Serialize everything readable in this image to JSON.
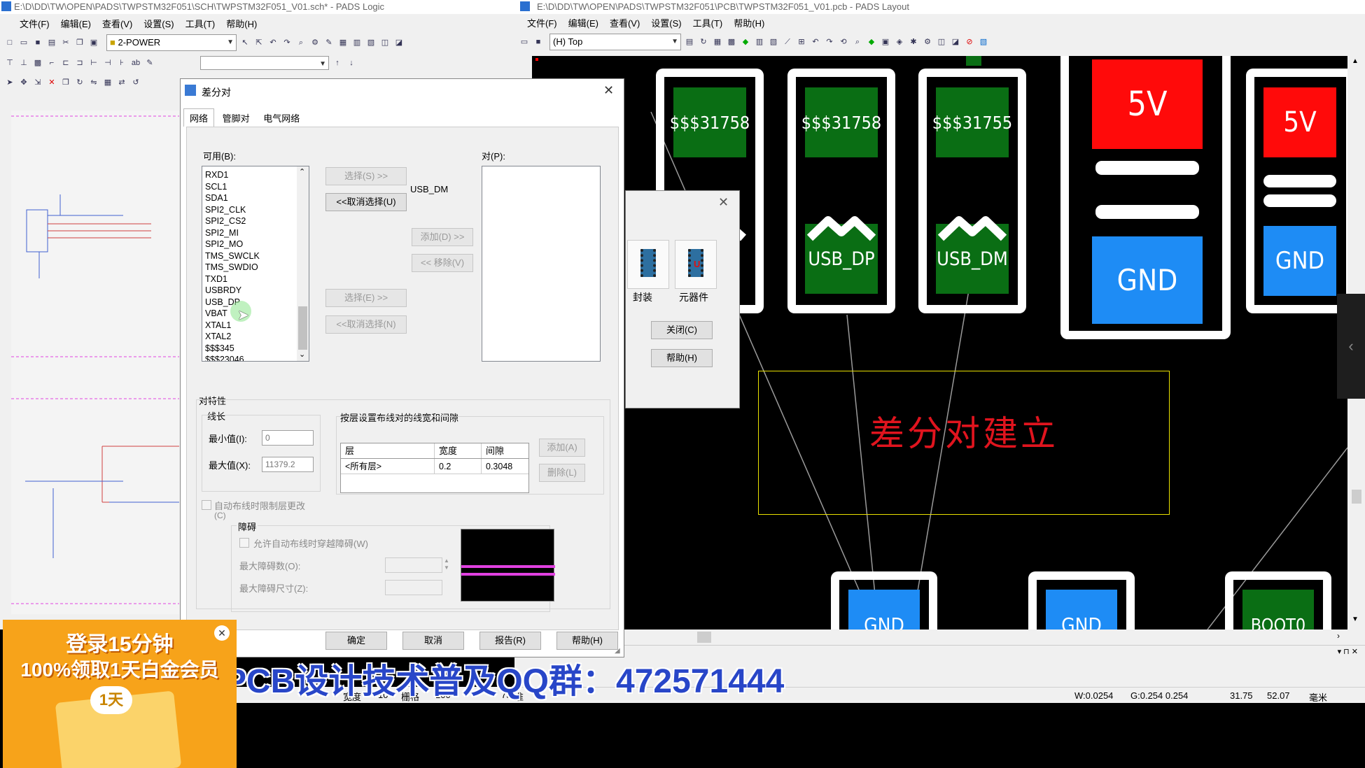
{
  "logic_window": {
    "title": "E:\\D\\DD\\TW\\OPEN\\PADS\\TWPSTM32F051\\SCH\\TWPSTM32F051_V01.sch* - PADS Logic",
    "menus": [
      "文件(F)",
      "编辑(E)",
      "查看(V)",
      "设置(S)",
      "工具(T)",
      "帮助(H)"
    ],
    "layer_combo": "2-POWER"
  },
  "layout_window": {
    "title": "E:\\D\\DD\\TW\\OPEN\\PADS\\TWPSTM32F051\\PCB\\TWPSTM32F051_V01.pcb - PADS Layout",
    "menus": [
      "文件(F)",
      "编辑(E)",
      "查看(V)",
      "设置(S)",
      "工具(T)",
      "帮助(H)"
    ],
    "layer_combo": "(H) Top",
    "status": {
      "w": "W:0.0254",
      "g": "G:0.254 0.254",
      "x": "31.75",
      "y": "52.07",
      "unit": "毫米"
    },
    "bottom_status": {
      "width_label": "宽度",
      "width_value": "10",
      "grid_label": "栅格",
      "grid_value": "100",
      "num": "75",
      "ready": "准备就绪"
    }
  },
  "pcb": {
    "pads": [
      {
        "name": "$$$31758",
        "color": "green"
      },
      {
        "name": "$$$31758",
        "color": "green"
      },
      {
        "name": "$$$31755",
        "color": "green"
      },
      {
        "name": "5V",
        "color": "red"
      },
      {
        "name": "5V",
        "color": "red"
      },
      {
        "name": "USB_DP",
        "color": "green"
      },
      {
        "name": "USB_DM",
        "color": "green"
      },
      {
        "name": "GND",
        "color": "blue"
      },
      {
        "name": "GND",
        "color": "blue"
      },
      {
        "name": "GND",
        "color": "blue"
      },
      {
        "name": "GND",
        "color": "blue"
      },
      {
        "name": "BOOT0",
        "color": "green"
      }
    ],
    "annotation": "差分对建立"
  },
  "diff_dialog": {
    "title": "差分对",
    "tabs": [
      "网络",
      "管脚对",
      "电气网络"
    ],
    "available_label": "可用(B):",
    "available_items": [
      "RXD1",
      "SCL1",
      "SDA1",
      "SPI2_CLK",
      "SPI2_CS2",
      "SPI2_MI",
      "SPI2_MO",
      "TMS_SWCLK",
      "TMS_SWDIO",
      "TXD1",
      "USBRDY",
      "USB_DP",
      "VBAT",
      "XTAL1",
      "XTAL2",
      "$$$345",
      "$$$23046"
    ],
    "selected_net": "USB_DM",
    "pairs_label": "对(P):",
    "buttons": {
      "select_s": "选择(S) >>",
      "deselect_u": "<<取消选择(U)",
      "add_d": "添加(D) >>",
      "remove_v": "<< 移除(V)",
      "select_e": "选择(E) >>",
      "deselect_n": "<<取消选择(N)",
      "add_a": "添加(A)",
      "delete_l": "删除(L)",
      "ok": "确定",
      "cancel": "取消",
      "report": "报告(R)",
      "help": "帮助(H)"
    },
    "pair_props": "对特性",
    "length": "线长",
    "min_label": "最小值(I):",
    "min_value": "0",
    "max_label": "最大值(X):",
    "max_value": "11379.2",
    "layer_rules_label": "按层设置布线对的线宽和间隙",
    "table_headers": [
      "层",
      "宽度",
      "间隙"
    ],
    "table_row": [
      "<所有层>",
      "0.2",
      "0.3048"
    ],
    "autoroute_check": "自动布线时限制层更改",
    "autoroute_check_key": "(C)",
    "obstacle": "障碍",
    "allow_obstacle": "允许自动布线时穿越障碍(W)",
    "max_obstacle_count": "最大障碍数(O):",
    "max_obstacle_size": "最大障碍尺寸(Z):"
  },
  "lib_dialog": {
    "package_label": "封装",
    "component_label": "元器件",
    "close_btn": "关闭(C)",
    "help_btn": "帮助(H)"
  },
  "overlay": {
    "qq_text": "PCB设计技术普及QQ群：472571444",
    "ad_line1": "登录15分钟",
    "ad_line2": "100%领取1天白金会员",
    "ad_day": "1天"
  },
  "colors": {
    "pad_green": "#0a6e14",
    "pad_blue": "#1e8cf5",
    "pad_red": "#ff0a0a",
    "annotation": "#e0141e",
    "qq_text": "#2846c8"
  }
}
